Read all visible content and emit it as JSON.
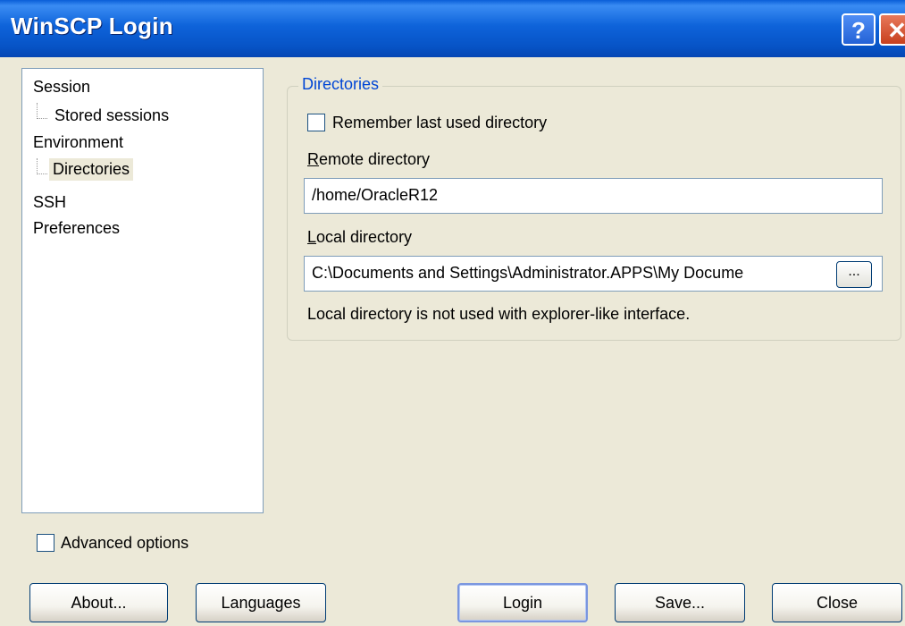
{
  "window": {
    "title": "WinSCP Login",
    "help_glyph": "?",
    "close_glyph": "✕"
  },
  "tree": {
    "items": [
      {
        "label": "Session"
      },
      {
        "label": "Stored sessions"
      },
      {
        "label": "Environment"
      },
      {
        "label": "Directories",
        "selected": true
      },
      {
        "label": "SSH"
      },
      {
        "label": "Preferences"
      }
    ]
  },
  "directories": {
    "group_title": "Directories",
    "remember_label": "Remember last used directory",
    "remember_checked": false,
    "remote_label_accel": "R",
    "remote_label_rest": "emote directory",
    "remote_value": "/home/OracleR12",
    "local_label_accel": "L",
    "local_label_rest": "ocal directory",
    "local_value": "C:\\Documents and Settings\\Administrator.APPS\\My Docume",
    "browse_label": "...",
    "note": "Local directory is not used with explorer-like interface."
  },
  "advanced": {
    "label": "Advanced options",
    "checked": false
  },
  "buttons": {
    "about": "About...",
    "languages": "Languages",
    "login": "Login",
    "save": "Save...",
    "close": "Close"
  },
  "colors": {
    "title_bar": "#0A5FD8",
    "dialog_bg": "#ECE9D8",
    "group_title": "#0046D5"
  }
}
